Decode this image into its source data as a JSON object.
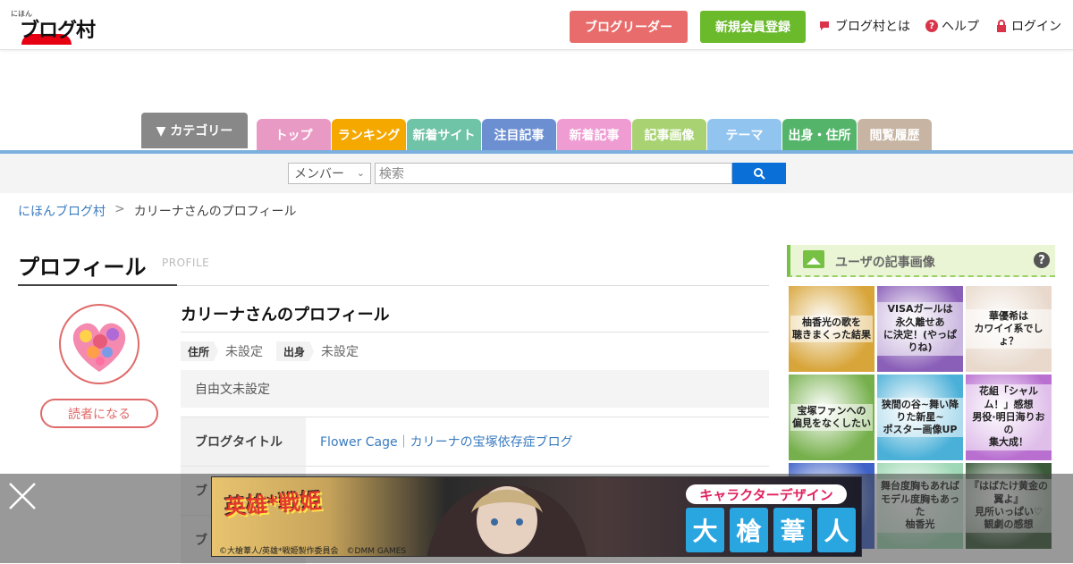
{
  "header": {
    "logo_small": "にほん",
    "logo_main": "ブログ村",
    "reader_label": "ブログリーダー",
    "register_label": "新規会員登録",
    "about_label": "ブログ村とは",
    "help_label": "ヘルプ",
    "login_label": "ログイン"
  },
  "nav": {
    "category_label": "▼ カテゴリー",
    "tabs": [
      {
        "label": "トップ",
        "color": "#e89ac4"
      },
      {
        "label": "ランキング",
        "color": "#f5a800"
      },
      {
        "label": "新着サイト",
        "color": "#6fc3a7"
      },
      {
        "label": "注目記事",
        "color": "#6c8fd2"
      },
      {
        "label": "新着記事",
        "color": "#ef9cd3"
      },
      {
        "label": "記事画像",
        "color": "#a9d372"
      },
      {
        "label": "テーマ",
        "color": "#92c4f0"
      },
      {
        "label": "出身・住所",
        "color": "#54b56a"
      },
      {
        "label": "閲覧履歴",
        "color": "#c7b4a2"
      }
    ]
  },
  "search": {
    "select_value": "メンバー",
    "placeholder": "検索"
  },
  "breadcrumb": {
    "home": "にほんブログ村",
    "separator": ">",
    "current": "カリーナさんのプロフィール"
  },
  "profile": {
    "title": "プロフィール",
    "title_en": "PROFILE",
    "follow_label": "読者になる",
    "name": "カリーナさんのプロフィール",
    "address_label": "住所",
    "address_value": "未設定",
    "origin_label": "出身",
    "origin_value": "未設定",
    "free_text": "自由文未設定",
    "rows": [
      {
        "th": "ブログタイトル",
        "td": "Flower Cage｜カリーナの宝塚依存症ブログ"
      },
      {
        "th": "ブ",
        "td": ""
      },
      {
        "th": "ブ",
        "td": ""
      }
    ]
  },
  "sidebar": {
    "title": "ユーザの記事画像",
    "help": "?",
    "thumbs": [
      {
        "text": "柚香光の歌を\n聴きまくった結果",
        "bg": "#d8a53a"
      },
      {
        "text": "VISAガールは\n永久離せあ\nに決定！(やっぱりね)",
        "bg": "#8a5fb8"
      },
      {
        "text": "華優希は\nカワイイ系でしょ？",
        "bg": "#e8d9cc"
      },
      {
        "text": "宝塚ファンへの\n偏見をなくしたい",
        "bg": "#76b04c"
      },
      {
        "text": "狭間の谷~舞い降りた新星~\nポスター画像UP",
        "bg": "#4ab0d8"
      },
      {
        "text": "花組「シャルム！」感想\n男役·明日海りおの\n集大成！",
        "bg": "#b86fd0"
      },
      {
        "text": "",
        "bg": "#3f62c8"
      },
      {
        "text": "舞台度胸もあれば\nモデル度胸もあった\n柚香光",
        "bg": "#9ed8b4"
      },
      {
        "text": "『はばたけ黄金の翼よ』\n見所いっぱい♡\n観劇の感想",
        "bg": "#3a5a3a"
      }
    ]
  },
  "ad": {
    "logo": "英雄*戦姫",
    "copyright": "©大槍葦人/英雄*戦姫製作委員会　©DMM GAMES",
    "role": "キャラクターデザイン",
    "name": [
      "大",
      "槍",
      "葦",
      "人"
    ]
  }
}
